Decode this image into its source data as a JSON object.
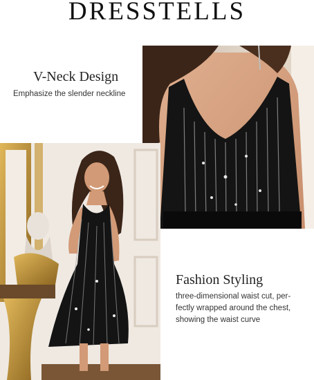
{
  "brand": {
    "name": "DRESSTELLS"
  },
  "features": {
    "vneck": {
      "title": "V-Neck Design",
      "description": "Emphasize the slender neckline"
    },
    "fashion": {
      "title": "Fashion Styling",
      "description_lines": [
        "three-dimensional waist cut, per-",
        "fectly wrapped around the chest,",
        "showing the waist curve"
      ]
    }
  },
  "colors": {
    "dress": "#141414",
    "sequin": "#cfcfcf",
    "skin": "#d29a76",
    "hair": "#3b2518",
    "wall": "#efe9e2",
    "gold": "#c79a3e"
  },
  "icons": {
    "earring": "earring-icon",
    "statue": "bust-statue"
  }
}
